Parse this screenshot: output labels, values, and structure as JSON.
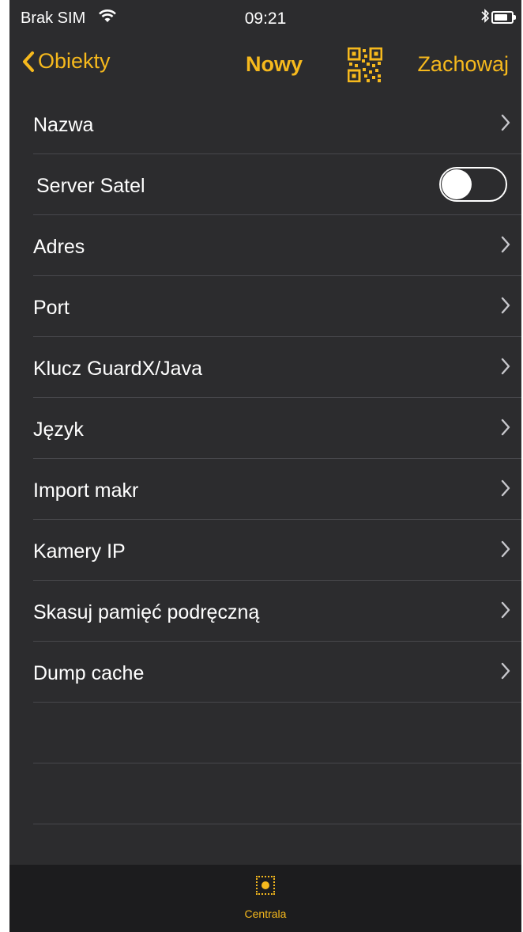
{
  "status_bar": {
    "carrier": "Brak SIM",
    "time": "09:21",
    "wifi_icon": "wifi-icon",
    "bluetooth_icon": "bluetooth-icon",
    "battery_icon": "battery-icon"
  },
  "nav": {
    "back_label": "Obiekty",
    "title": "Nowy",
    "qr_icon": "qr-code-icon",
    "save_label": "Zachowaj"
  },
  "list": {
    "items": [
      {
        "label": "Nazwa"
      },
      {
        "label": "Server Satel",
        "toggle": false
      },
      {
        "label": "Adres"
      },
      {
        "label": "Port"
      },
      {
        "label": "Klucz GuardX/Java"
      },
      {
        "label": "Język"
      },
      {
        "label": "Import makr"
      },
      {
        "label": "Kamery IP"
      },
      {
        "label": "Skasuj pamięć podręczną"
      },
      {
        "label": "Dump cache"
      }
    ]
  },
  "tabbar": {
    "tabs": [
      {
        "label": "Centrala",
        "icon": "centrala-icon",
        "active": true
      }
    ]
  },
  "colors": {
    "accent": "#f6b91d",
    "background": "#2c2c2e",
    "separator": "#48484c",
    "tabbar": "#1c1c1e"
  }
}
